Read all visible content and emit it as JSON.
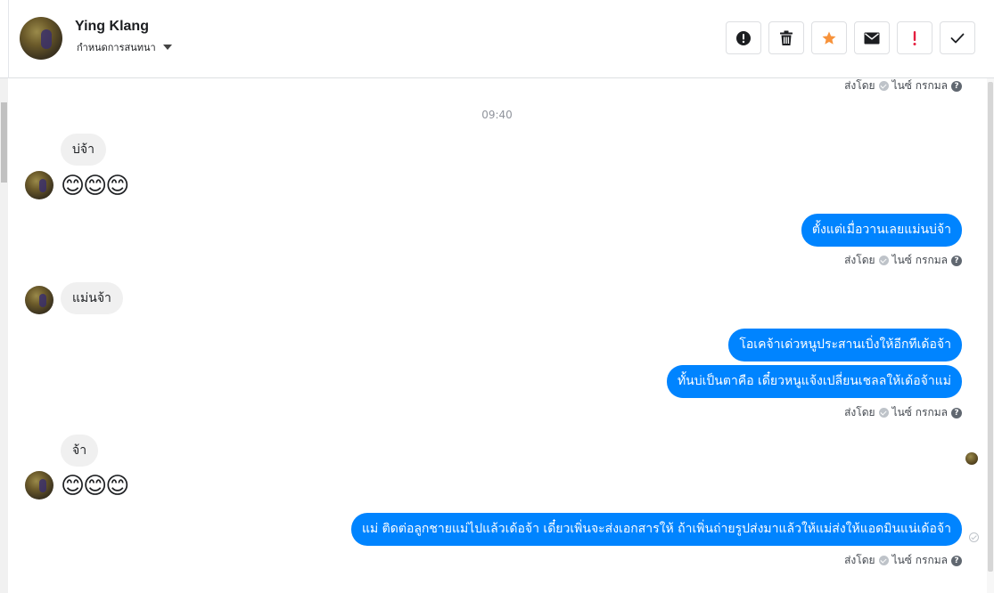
{
  "header": {
    "contact_name": "Ying Klang",
    "assign_label": "กำหนดการสนทนา",
    "toolbar": [
      {
        "name": "spam-button",
        "icon": "exclamation-circle-icon"
      },
      {
        "name": "delete-button",
        "icon": "trash-icon"
      },
      {
        "name": "star-button",
        "icon": "star-icon",
        "color": "#f7923a"
      },
      {
        "name": "mark-unread-button",
        "icon": "envelope-icon"
      },
      {
        "name": "follow-up-button",
        "icon": "exclamation-icon",
        "color": "#e41e3f"
      },
      {
        "name": "done-button",
        "icon": "check-icon"
      }
    ]
  },
  "colors": {
    "outgoing_bubble": "#0084ff",
    "incoming_bubble": "#f0f0f0"
  },
  "meta": {
    "sent_by_label": "ส่งโดย",
    "sender_name": "ไนซ์ กรกมล"
  },
  "messages": {
    "timestamp": "09:40",
    "in_1": "บ่จ้า",
    "in_1_emoji": "😊😊😊",
    "out_1": "ตั้งแต่เมื่อวานเลยแม่นบ่จ้า",
    "in_2": "แม่นจ้า",
    "out_2": "โอเคจ้าเด่วหนูประสานเบิ่งให้อีกทีเด้อจ้า",
    "out_3": "ทั้นบ่เป็นตาคือ เดี๋ยวหนูแจ้งเปลี่ยนเชลลให้เด้อจ้าแม่",
    "in_3": "จ้า",
    "in_3_emoji": "😊😊😊",
    "out_4": "แม่ ติดต่อลูกชายแม่ไปแล้วเด้อจ้า เดี๋ยวเพิ่นจะส่งเอกสารให้ ถ้าเพิ่นถ่ายรูปส่งมาแล้วให้แม่ส่งให้แอดมินแน่เด้อจ้า"
  }
}
